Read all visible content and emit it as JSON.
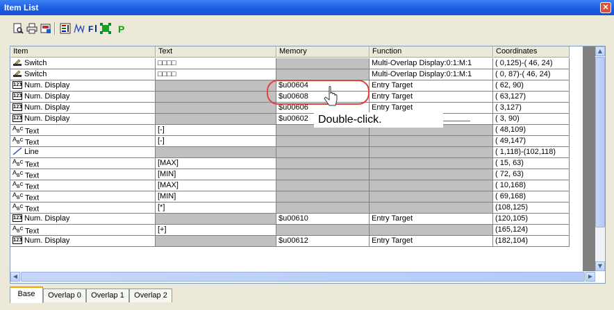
{
  "window": {
    "title": "Item List",
    "close_icon": "close-icon"
  },
  "toolbar": {
    "buttons": [
      "print-preview-icon",
      "print-icon",
      "save-image-icon",
      "list-view-icon",
      "waveform-icon",
      "filter-icon",
      "select-icon",
      "p-icon"
    ]
  },
  "grid": {
    "columns": [
      "Item",
      "Text",
      "Memory",
      "Function",
      "Coordinates"
    ],
    "rows": [
      {
        "icon": "switch-icon",
        "item": "Switch",
        "text": "□□□□",
        "memory": "",
        "function": "Multi-Overlap Display:0:1:M:1",
        "coords": "( 0,125)-( 46, 24)",
        "gray": [
          "memory"
        ]
      },
      {
        "icon": "switch-icon",
        "item": "Switch",
        "text": "□□□□",
        "memory": "",
        "function": "Multi-Overlap Display:0:1:M:1",
        "coords": "( 0, 87)-( 46, 24)",
        "gray": [
          "memory"
        ]
      },
      {
        "icon": "num-display-icon",
        "item": "Num. Display",
        "text": "",
        "memory": "$u00604",
        "function": "Entry Target",
        "coords": "( 62, 90)",
        "gray": [
          "text"
        ]
      },
      {
        "icon": "num-display-icon",
        "item": "Num. Display",
        "text": "",
        "memory": "$u00608",
        "function": "Entry Target",
        "coords": "( 63,127)",
        "gray": [
          "text"
        ]
      },
      {
        "icon": "num-display-icon",
        "item": "Num. Display",
        "text": "",
        "memory": "$u00606",
        "function": "Entry Target",
        "coords": "( 3,127)",
        "gray": [
          "text"
        ]
      },
      {
        "icon": "num-display-icon",
        "item": "Num. Display",
        "text": "",
        "memory": "$u00602",
        "function": "",
        "coords": "( 3, 90)",
        "gray": [
          "text"
        ]
      },
      {
        "icon": "text-icon",
        "item": "Text",
        "text": "[-]",
        "memory": "",
        "function": "",
        "coords": "( 48,109)",
        "gray": [
          "memory",
          "function"
        ]
      },
      {
        "icon": "text-icon",
        "item": "Text",
        "text": "[-]",
        "memory": "",
        "function": "",
        "coords": "( 49,147)",
        "gray": [
          "memory",
          "function"
        ]
      },
      {
        "icon": "line-icon",
        "item": "Line",
        "text": "",
        "memory": "",
        "function": "",
        "coords": "( 1,118)-(102,118)",
        "gray": [
          "text",
          "memory",
          "function"
        ]
      },
      {
        "icon": "text-icon",
        "item": "Text",
        "text": "[MAX]",
        "memory": "",
        "function": "",
        "coords": "( 15, 63)",
        "gray": [
          "memory",
          "function"
        ]
      },
      {
        "icon": "text-icon",
        "item": "Text",
        "text": "[MIN]",
        "memory": "",
        "function": "",
        "coords": "( 72, 63)",
        "gray": [
          "memory",
          "function"
        ]
      },
      {
        "icon": "text-icon",
        "item": "Text",
        "text": "[MAX]",
        "memory": "",
        "function": "",
        "coords": "( 10,168)",
        "gray": [
          "memory",
          "function"
        ]
      },
      {
        "icon": "text-icon",
        "item": "Text",
        "text": "[MIN]",
        "memory": "",
        "function": "",
        "coords": "( 69,168)",
        "gray": [
          "memory",
          "function"
        ]
      },
      {
        "icon": "text-icon",
        "item": "Text",
        "text": "[*]",
        "memory": "",
        "function": "",
        "coords": "(108,125)",
        "gray": [
          "memory",
          "function"
        ]
      },
      {
        "icon": "num-display-icon",
        "item": "Num. Display",
        "text": "",
        "memory": "$u00610",
        "function": "Entry Target",
        "coords": "(120,105)",
        "gray": [
          "text"
        ]
      },
      {
        "icon": "text-icon",
        "item": "Text",
        "text": "[+]",
        "memory": "",
        "function": "",
        "coords": "(165,124)",
        "gray": [
          "memory",
          "function"
        ]
      },
      {
        "icon": "num-display-icon",
        "item": "Num. Display",
        "text": "",
        "memory": "$u00612",
        "function": "Entry Target",
        "coords": "(182,104)",
        "gray": [
          "text"
        ]
      }
    ]
  },
  "callout": {
    "text": "Double-click."
  },
  "tabs": [
    "Base",
    "Overlap 0",
    "Overlap 1",
    "Overlap 2"
  ],
  "active_tab": "Base",
  "colors": {
    "titlebar": "#1C5AE0",
    "callout_oval": "#E04040",
    "gray_cell": "#C0C0C0",
    "active_tab_accent": "#F2A300"
  }
}
